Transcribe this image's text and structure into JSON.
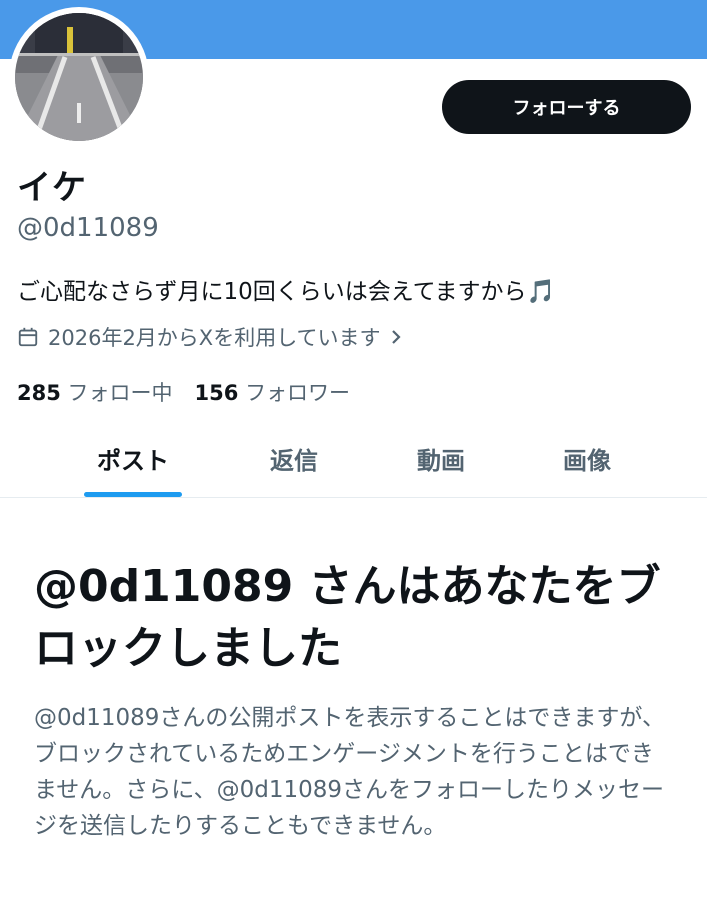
{
  "profile": {
    "avatar_alt": "avatar",
    "follow_button": "フォローする",
    "display_name": "イケ",
    "handle": "@0d11089",
    "bio": "ご心配なさらず月に10回くらいは会えてますから🎵",
    "joined": "2026年2月からXを利用しています",
    "following_count": "285",
    "following_label": "フォロー中",
    "followers_count": "156",
    "followers_label": "フォロワー"
  },
  "tabs": [
    {
      "label": "ポスト",
      "active": true
    },
    {
      "label": "返信",
      "active": false
    },
    {
      "label": "動画",
      "active": false
    },
    {
      "label": "画像",
      "active": false
    }
  ],
  "blocked": {
    "title": "@0d11089 さんはあなたをブロックしました",
    "description": "@0d11089さんの公開ポストを表示することはできますが、ブロックされているためエンゲージメントを行うことはできません。さらに、@0d11089さんをフォローしたりメッセージを送信したりすることもできません。"
  },
  "colors": {
    "banner": "#4a99e9",
    "accent": "#1d9bf0",
    "text": "#0f1419",
    "muted": "#536471"
  },
  "icons": [
    "calendar-icon",
    "chevron-right-icon"
  ]
}
